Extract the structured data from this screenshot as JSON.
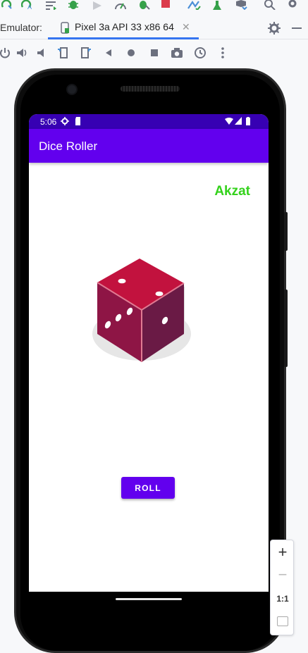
{
  "ide": {
    "toolbar_icons": [
      "apply-changes-icon",
      "apply-code-changes-icon",
      "logcat-icon",
      "debug-icon",
      "profiler-icon",
      "speedometer-icon",
      "attach-debugger-icon",
      "stop-icon",
      "sync-icon",
      "run-tests-icon",
      "sdk-manager-icon",
      "search-icon",
      "settings-icon"
    ],
    "colors": {
      "accent": "#3574f0",
      "stop": "#db3b4b",
      "green": "#36a14a"
    }
  },
  "emulator_tab": {
    "label": "Emulator:",
    "device_name": "Pixel 3a API 33 x86 64",
    "close_glyph": "✕"
  },
  "controls": [
    "power-icon",
    "volume-up-icon",
    "volume-down-icon",
    "rotate-left-icon",
    "rotate-right-icon",
    "back-icon",
    "home-icon",
    "overview-icon",
    "camera-icon",
    "snapshot-icon",
    "more-icon"
  ],
  "phone": {
    "status": {
      "time": "5:06"
    },
    "app": {
      "title": "Dice Roller",
      "name_label": "Akzat",
      "roll_button": "ROLL",
      "colors": {
        "primary": "#6200ee",
        "primary_dark": "#3700b3",
        "name_green": "#34d21c",
        "dice_top": "#c2123e",
        "dice_left": "#8e1545",
        "dice_right": "#6a1a45"
      }
    }
  },
  "zoom": {
    "zoom_in": "+",
    "zoom_out": "−",
    "actual_size": "1:1"
  }
}
